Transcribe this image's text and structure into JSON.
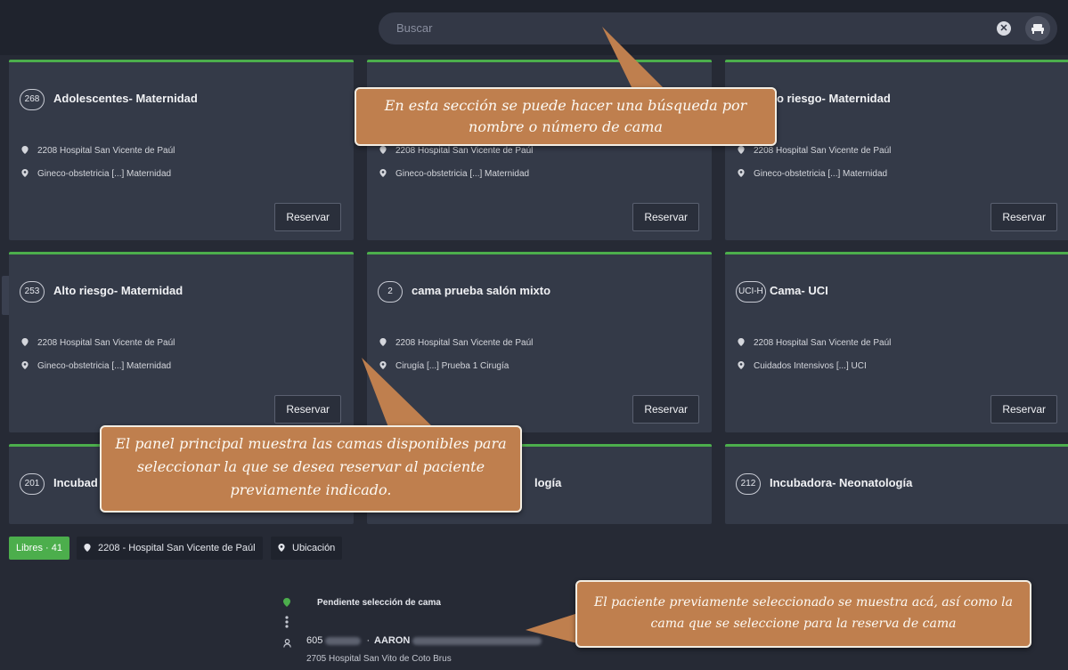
{
  "search": {
    "placeholder": "Buscar",
    "clear_glyph": "✕"
  },
  "cards": [
    {
      "number": "268",
      "title": "Adolescentes- Maternidad",
      "hospital": "2208 Hospital San Vicente de Paúl",
      "location": "Gineco-obstetricia [...] Maternidad",
      "action": "Reservar"
    },
    {
      "number": "",
      "title": "",
      "hospital": "2208 Hospital San Vicente de Paúl",
      "location": "Gineco-obstetricia [...] Maternidad",
      "action": "Reservar"
    },
    {
      "number": "",
      "title": "lto riesgo- Maternidad",
      "hospital": "2208 Hospital San Vicente de Paúl",
      "location": "Gineco-obstetricia [...] Maternidad",
      "action": "Reservar"
    },
    {
      "number": "253",
      "title": "Alto riesgo- Maternidad",
      "hospital": "2208 Hospital San Vicente de Paúl",
      "location": "Gineco-obstetricia [...] Maternidad",
      "action": "Reservar"
    },
    {
      "number": "2",
      "title": "cama prueba salón mixto",
      "hospital": "2208 Hospital San Vicente de Paúl",
      "location": "Cirugía [...] Prueba 1 Cirugía",
      "action": "Reservar"
    },
    {
      "number": "UCI-H",
      "title": "Cama- UCI",
      "hospital": "2208 Hospital San Vicente de Paúl",
      "location": "Cuidados Intensivos [...] UCI",
      "action": "Reservar"
    },
    {
      "number": "201",
      "title": "Incubad",
      "hospital": "",
      "location": "",
      "action": ""
    },
    {
      "number": "",
      "title": "logía",
      "hospital": "",
      "location": "",
      "action": ""
    },
    {
      "number": "212",
      "title": "Incubadora- Neonatología",
      "hospital": "",
      "location": "",
      "action": ""
    }
  ],
  "filters": {
    "free": "Libres · 41",
    "hospital": "2208 - Hospital San Vicente de Paúl",
    "location": "Ubicación"
  },
  "patient": {
    "status": "Pendiente selección de cama",
    "id": "605",
    "name": "AARON",
    "hospital": "2705 Hospital San Vito de Coto Brus"
  },
  "callouts": {
    "search": "En esta sección se puede hacer una búsqueda por nombre o número de cama",
    "panel": "El panel principal muestra las camas disponibles para seleccionar la que se desea reservar al paciente previamente indicado.",
    "patient": "El paciente previamente seleccionado se muestra acá, así como la cama que se seleccione para la reserva de cama"
  },
  "colors": {
    "accent_green": "#4cae4c",
    "callout_fill": "#bf7f4e",
    "background": "#262a35"
  }
}
